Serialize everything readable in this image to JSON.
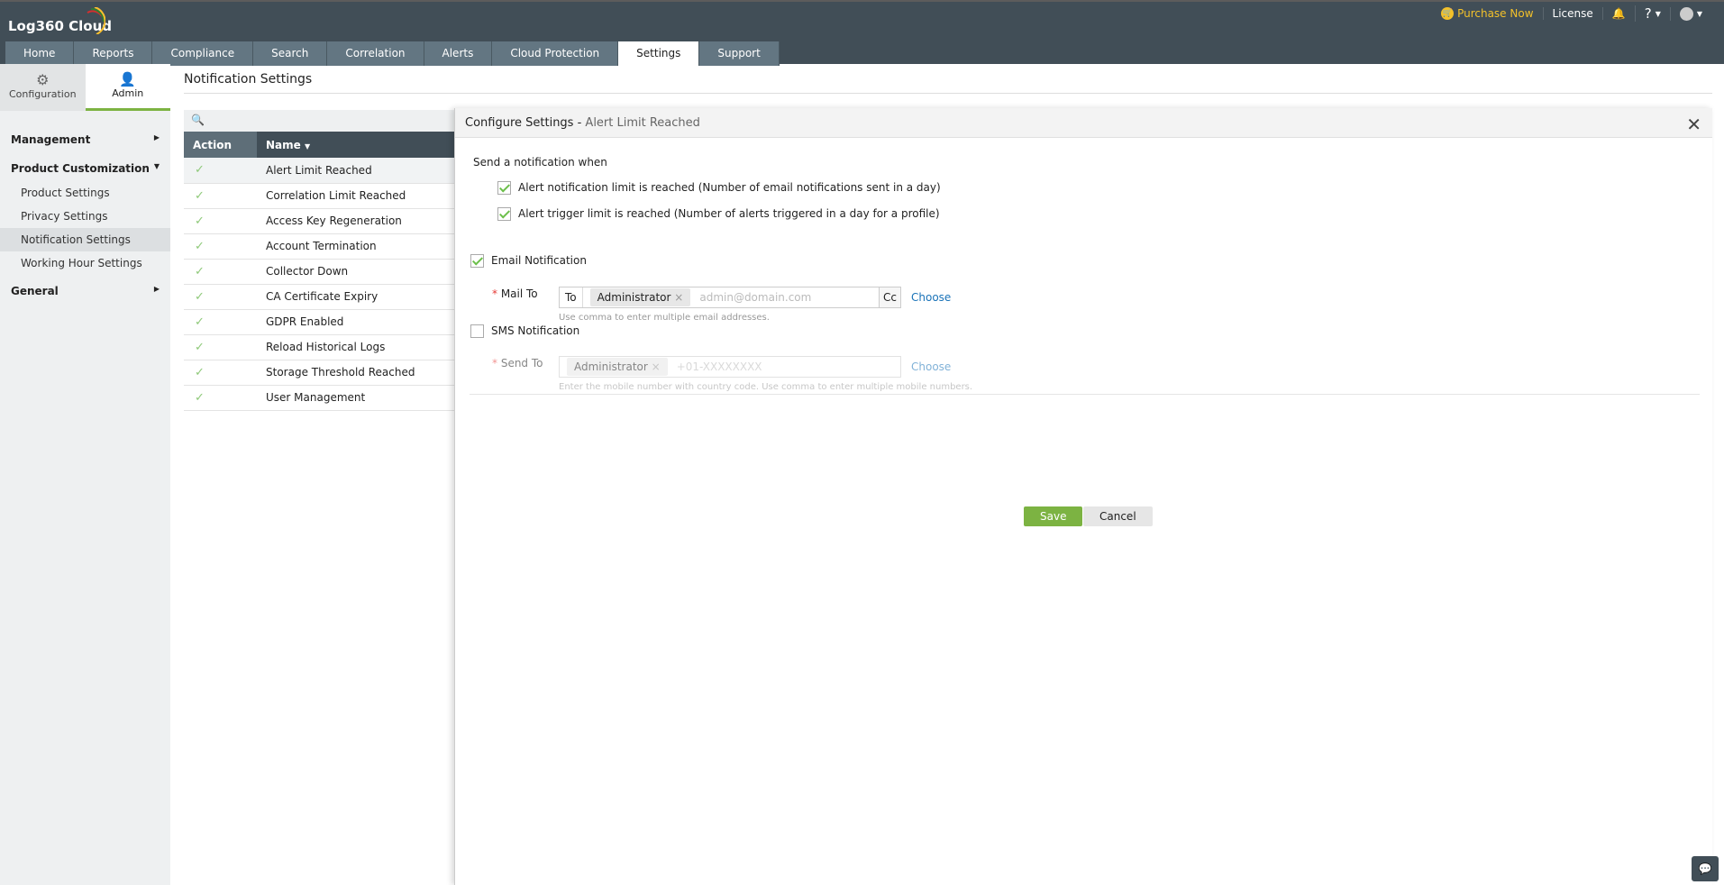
{
  "app": {
    "title": "Log360 Cloud"
  },
  "topbar": {
    "purchase": "Purchase Now",
    "license": "License",
    "help": "?"
  },
  "tabs": [
    "Home",
    "Reports",
    "Compliance",
    "Search",
    "Correlation",
    "Alerts",
    "Cloud Protection",
    "Settings",
    "Support"
  ],
  "subtabs": {
    "config": "Configuration",
    "admin": "Admin"
  },
  "menu": {
    "management": "Management",
    "product_customization": "Product Customization",
    "items": [
      "Product Settings",
      "Privacy Settings",
      "Notification Settings",
      "Working Hour Settings"
    ],
    "general": "General"
  },
  "page": {
    "title": "Notification Settings"
  },
  "table": {
    "headers": {
      "action": "Action",
      "name": "Name"
    },
    "rows": [
      "Alert Limit Reached",
      "Correlation Limit Reached",
      "Access Key Regeneration",
      "Account Termination",
      "Collector Down",
      "CA Certificate Expiry",
      "GDPR Enabled",
      "Reload Historical Logs",
      "Storage Threshold Reached",
      "User Management"
    ]
  },
  "dialog": {
    "title": "Configure Settings - ",
    "subtitle": "Alert Limit Reached",
    "send_when": "Send a notification when",
    "opt1": "Alert notification limit is reached (Number of email notifications sent in a day)",
    "opt2": "Alert trigger limit is reached (Number of alerts triggered in a day for a profile)",
    "email_label": "Email Notification",
    "mail_to": "Mail To",
    "to": "To",
    "chip": "Administrator",
    "email_placeholder": "admin@domain.com",
    "cc": "Cc",
    "choose": "Choose",
    "email_hint": "Use comma to enter multiple email addresses.",
    "sms_label": "SMS Notification",
    "send_to": "Send To",
    "sms_placeholder": "+01-XXXXXXXX",
    "sms_hint": "Enter the mobile number with country code. Use comma to enter multiple mobile numbers.",
    "save": "Save",
    "cancel": "Cancel"
  }
}
